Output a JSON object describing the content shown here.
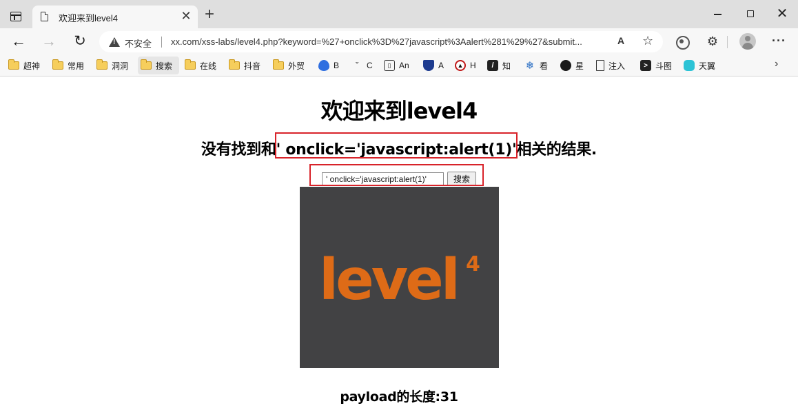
{
  "browser": {
    "tab": {
      "title": "欢迎来到level4",
      "close_glyph": "✕"
    },
    "new_tab_glyph": "+",
    "window": {
      "close_glyph": "✕"
    },
    "nav": {
      "back_glyph": "←",
      "forward_glyph": "→",
      "reload_glyph": "↻"
    },
    "address_bar": {
      "security_label": "不安全",
      "url": "xx.com/xss-labs/level4.php?keyword=%27+onclick%3D%27javascript%3Aalert%281%29%27&submit..."
    },
    "toolbar_icons": {
      "read_aloud": "A",
      "favorites_add": "☆",
      "extensions": "⚙",
      "more": "···"
    },
    "bookmarks": [
      {
        "label": "超神",
        "icon": "folder-icon"
      },
      {
        "label": "常用",
        "icon": "folder-icon"
      },
      {
        "label": "洞洞",
        "icon": "folder-icon"
      },
      {
        "label": "搜索",
        "icon": "folder-icon"
      },
      {
        "label": "在线",
        "icon": "folder-icon"
      },
      {
        "label": "抖音",
        "icon": "folder-icon"
      },
      {
        "label": "外贸",
        "icon": "folder-icon"
      },
      {
        "label": "B",
        "icon": "flame-icon"
      },
      {
        "label": "C",
        "icon": "caret-icon"
      },
      {
        "label": "An",
        "icon": "book-icon"
      },
      {
        "label": "A",
        "icon": "shield-icon"
      },
      {
        "label": "H",
        "icon": "h-logo-icon"
      },
      {
        "label": "知",
        "icon": "zhihu-icon"
      },
      {
        "label": "看",
        "icon": "snowflake-icon"
      },
      {
        "label": "星",
        "icon": "github-icon"
      },
      {
        "label": "注入",
        "icon": "page-icon"
      },
      {
        "label": "斗图",
        "icon": "terminal-icon"
      },
      {
        "label": "天翼",
        "icon": "cloud-icon"
      }
    ],
    "bookmarks_more": "›",
    "active_bookmark": "搜索"
  },
  "page": {
    "heading": "欢迎来到level4",
    "result_prefix": "没有找到和",
    "result_keyword": "' onclick='javascript:alert(1)'",
    "result_suffix": "相关的结果.",
    "search_input_value": "' onclick='javascript:alert(1)'",
    "search_button_label": "搜索",
    "image_text": "level",
    "image_superscript": "4",
    "payload_text": "payload的长度:31"
  },
  "colors": {
    "highlight_box": "#d8232a",
    "level_image_bg": "#424244",
    "level_logo": "#de6b17"
  }
}
